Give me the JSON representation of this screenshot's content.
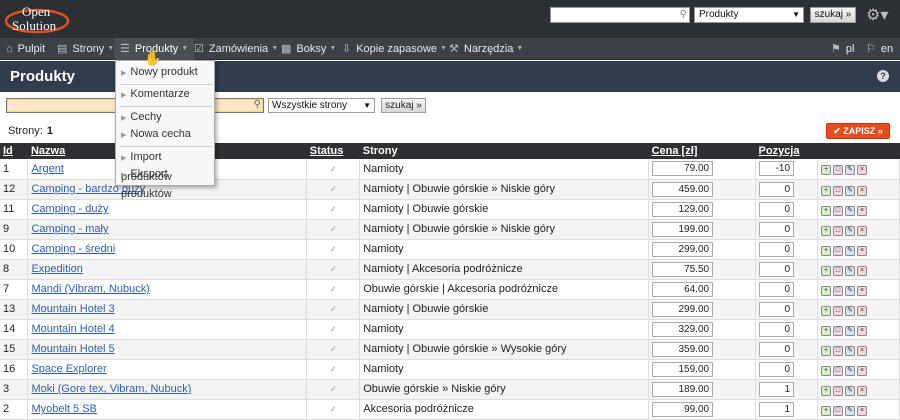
{
  "app": {
    "logo_top": "Open",
    "logo_bottom": "Solution"
  },
  "topbar": {
    "search_value": "",
    "search_icon": "search-icon",
    "scope_select": "Produkty",
    "search_button": "szukaj »",
    "gear_icon": "gear-icon"
  },
  "nav": {
    "items": [
      {
        "label": "Pulpit",
        "icon": "home-icon",
        "caret": false
      },
      {
        "label": "Strony",
        "icon": "page-icon",
        "caret": true
      },
      {
        "label": "Produkty",
        "icon": "list-icon",
        "caret": true
      },
      {
        "label": "Zamówienia",
        "icon": "cart-icon",
        "caret": true
      },
      {
        "label": "Boksy",
        "icon": "cube-icon",
        "caret": true
      },
      {
        "label": "Kopie zapasowe",
        "icon": "download-icon",
        "caret": true
      },
      {
        "label": "Narzędzia",
        "icon": "wrench-icon",
        "caret": true
      }
    ],
    "lang_pl": "pl",
    "lang_en": "en"
  },
  "page": {
    "title": "Produkty"
  },
  "filter": {
    "search_value": "",
    "scope_select": "Wszystkie strony",
    "search_button": "szukaj »"
  },
  "pages": {
    "label": "Strony:",
    "value": "1"
  },
  "save_button": "ZAPISZ »",
  "dropdown": {
    "items": [
      "Nowy produkt",
      "Komentarze",
      "Cechy",
      "Nowa cecha",
      "Import produktów",
      "Eksport produktów"
    ]
  },
  "table": {
    "headers": {
      "id": "Id",
      "name": "Nazwa",
      "status": "Status",
      "pages": "Strony",
      "price": "Cena [zł]",
      "position": "Pozycja"
    },
    "rows": [
      {
        "id": "1",
        "name": "Argent",
        "pages": "Namioty",
        "price": "79.00",
        "position": "-10"
      },
      {
        "id": "12",
        "name": "Camping - bardzo duży",
        "pages": "Namioty | Obuwie górskie » Niskie góry",
        "price": "459.00",
        "position": "0"
      },
      {
        "id": "11",
        "name": "Camping - duży",
        "pages": "Namioty | Obuwie górskie",
        "price": "129.00",
        "position": "0"
      },
      {
        "id": "9",
        "name": "Camping - mały",
        "pages": "Namioty | Obuwie górskie » Niskie góry",
        "price": "199.00",
        "position": "0"
      },
      {
        "id": "10",
        "name": "Camping - średni",
        "pages": "Namioty",
        "price": "299.00",
        "position": "0"
      },
      {
        "id": "8",
        "name": "Expedition",
        "pages": "Namioty | Akcesoria podróżnicze",
        "price": "75.50",
        "position": "0"
      },
      {
        "id": "7",
        "name": "Mandi (Vibram, Nubuck)",
        "pages": "Obuwie górskie | Akcesoria podróżnicze",
        "price": "64.00",
        "position": "0"
      },
      {
        "id": "13",
        "name": "Mountain Hotel 3",
        "pages": "Namioty | Obuwie górskie",
        "price": "299.00",
        "position": "0"
      },
      {
        "id": "14",
        "name": "Mountain Hotel 4",
        "pages": "Namioty",
        "price": "329.00",
        "position": "0"
      },
      {
        "id": "15",
        "name": "Mountain Hotel 5",
        "pages": "Namioty | Obuwie górskie » Wysokie góry",
        "price": "359.00",
        "position": "0"
      },
      {
        "id": "16",
        "name": "Space Explorer",
        "pages": "Namioty",
        "price": "159.00",
        "position": "0"
      },
      {
        "id": "3",
        "name": "Moki (Gore tex, Vibram, Nubuck)",
        "pages": "Obuwie górskie » Niskie góry",
        "price": "189.00",
        "position": "1"
      },
      {
        "id": "2",
        "name": "Myobelt 5 SB",
        "pages": "Akcesoria podróżnicze",
        "price": "99.00",
        "position": "1"
      }
    ]
  }
}
